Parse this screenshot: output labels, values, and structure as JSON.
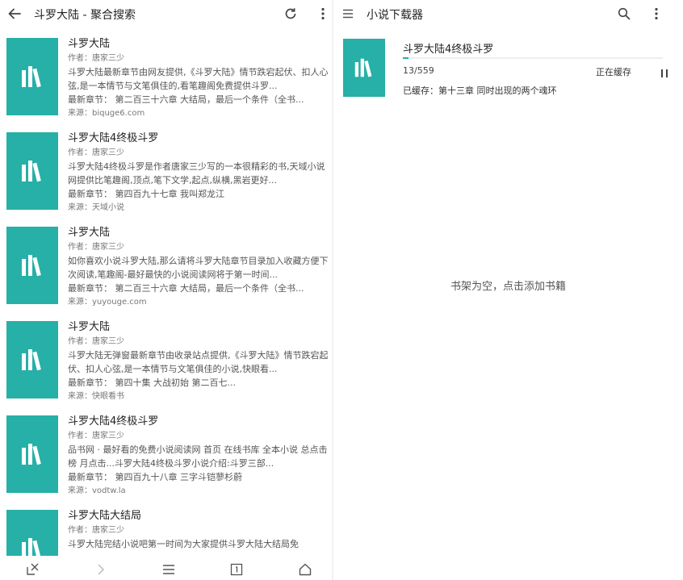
{
  "left": {
    "title": "斗罗大陆 - 聚合搜索",
    "icons": {
      "back": "arrow-left-icon",
      "refresh": "refresh-icon",
      "more": "more-vert-icon"
    },
    "results": [
      {
        "title": "斗罗大陆",
        "author": "作者：唐家三少",
        "desc": "斗罗大陆最新章节由网友提供,《斗罗大陆》情节跌宕起伏、扣人心弦,是一本情节与文笔俱佳的,看笔趣阁免费提供斗罗...",
        "latest": "最新章节： 第二百三十六章 大结局，最后一个条件（全书...",
        "source": "来源：biquge6.com"
      },
      {
        "title": "斗罗大陆4终极斗罗",
        "author": "作者：唐家三少",
        "desc": "斗罗大陆4终极斗罗是作者唐家三少写的一本很精彩的书,天域小说网提供比笔趣阁,顶点,笔下文学,起点,纵横,黑岩更好...",
        "latest": "最新章节： 第四百九十七章 我叫郑龙江",
        "source": "来源：天域小说"
      },
      {
        "title": "斗罗大陆",
        "author": "作者：唐家三少",
        "desc": "如你喜欢小说斗罗大陆,那么请将斗罗大陆章节目录加入收藏方便下次阅读,笔趣阁-最好最快的小说阅读网将于第一时间...",
        "latest": "最新章节： 第二百三十六章 大结局，最后一个条件（全书...",
        "source": "来源：yuyouge.com"
      },
      {
        "title": "斗罗大陆",
        "author": "作者：唐家三少",
        "desc": "斗罗大陆无弹窗最新章节由收录站点提供,《斗罗大陆》情节跌宕起伏、扣人心弦,是一本情节与文笔俱佳的小说,快眼看...",
        "latest": "最新章节： 第四十集 大战初始 第二百七...",
        "source": "来源：快眼看书"
      },
      {
        "title": "斗罗大陆4终极斗罗",
        "author": "作者：唐家三少",
        "desc": "品书网 · 最好看的免费小说阅读网 首页 在线书库 全本小说 总点击榜 月点击...斗罗大陆4终极斗罗小说介绍:斗罗三部...",
        "latest": "最新章节： 第四百九十八章 三字斗铠蓼杉蔚",
        "source": "来源：vodtw.la"
      },
      {
        "title": "斗罗大陆大结局",
        "author": "作者：唐家三少",
        "desc": "斗罗大陆完结小说吧第一时间为大家提供斗罗大陆大结局免",
        "latest": "",
        "source": ""
      }
    ],
    "bottom_icons": [
      "close-page-icon",
      "forward-icon",
      "menu-icon",
      "tabs-icon",
      "home-icon"
    ]
  },
  "right": {
    "title": "小说下载器",
    "icons": {
      "menu": "menu-icon",
      "search": "search-icon",
      "more": "more-vert-icon"
    },
    "download": {
      "title": "斗罗大陆4终极斗罗",
      "count": "13/559",
      "progress": 0.023,
      "status": "正在缓存",
      "cached": "已缓存：第十三章 同时出现的两个魂环"
    },
    "empty_message": "书架为空，点击添加书籍"
  },
  "colors": {
    "accent": "#26b0a7"
  }
}
